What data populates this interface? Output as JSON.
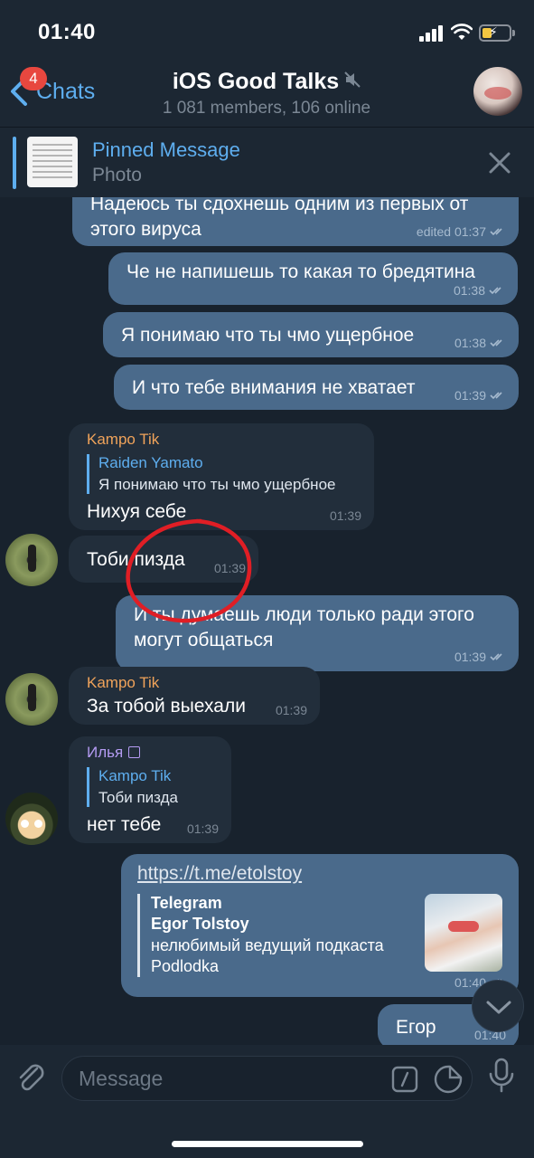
{
  "status": {
    "time": "01:40"
  },
  "nav": {
    "back_label": "Chats",
    "unread_badge": "4",
    "title": "iOS Good Talks",
    "subtitle": "1 081 members, 106 online"
  },
  "pinned": {
    "title": "Pinned Message",
    "subtitle": "Photo"
  },
  "messages": {
    "m1": {
      "text": "Надеюсь ты сдохнешь одним из первых от этого вируса",
      "meta": "edited 01:37"
    },
    "m2": {
      "text": "Че не напишешь то какая то бредятина",
      "meta": "01:38"
    },
    "m3": {
      "text": "Я понимаю что ты чмо ущербное",
      "meta": "01:38"
    },
    "m4": {
      "text": "И что тебе внимания не хватает",
      "meta": "01:39"
    },
    "m5": {
      "sender": "Kampo Tik",
      "reply_name": "Raiden Yamato",
      "reply_text": "Я понимаю что ты чмо ущербное",
      "text": "Нихуя себе",
      "meta": "01:39"
    },
    "m6": {
      "text": "Тоби пизда",
      "meta": "01:39"
    },
    "m7": {
      "text": "И ты думаешь люди только ради этого могут общаться",
      "meta": "01:39"
    },
    "m8": {
      "sender": "Kampo Tik",
      "text": "За тобой выехали",
      "meta": "01:39"
    },
    "m9": {
      "sender": "Илья",
      "reply_name": "Kampo Tik",
      "reply_text": "Тоби пизда",
      "text": "нет тебе",
      "meta": "01:39"
    },
    "m10": {
      "link": "https://t.me/etolstoy",
      "site": "Telegram",
      "title": "Egor Tolstoy",
      "desc": "нелюбимый ведущий подкаста Podlodka",
      "meta": "01:40"
    },
    "m11": {
      "text": "Егор",
      "meta": "01:40"
    }
  },
  "input": {
    "placeholder": "Message"
  },
  "colors": {
    "accent": "#5eaeef",
    "outgoing": "#4a6a8b",
    "incoming": "#222e3b",
    "badge": "#e8473f",
    "sender_kampo": "#f0a35a",
    "sender_ilya": "#b49bf2",
    "annotation": "#e01e25"
  }
}
